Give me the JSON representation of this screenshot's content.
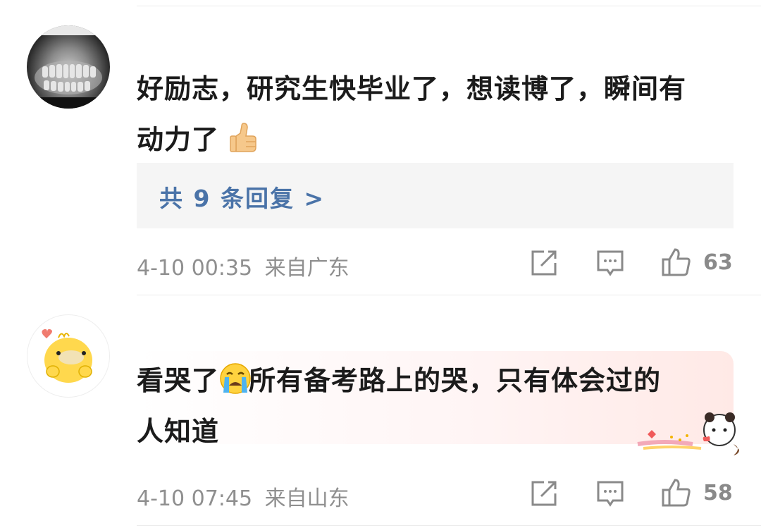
{
  "comments": [
    {
      "avatar": "x-ray-avatar",
      "text_part1": "好励志，研究生快毕业了，想读博了，瞬间有",
      "text_part2": "动力了",
      "emoji": "thumbs-up",
      "reply_link": "共 9 条回复 >",
      "time": "4-10 00:35",
      "location": "来自广东",
      "likes": "63"
    },
    {
      "avatar": "duck-avatar",
      "text_part1": "看哭了",
      "emoji": "loudly-crying-face",
      "text_part2": "所有备考路上的哭，只有体会过的",
      "text_part3": "人知道",
      "time": "4-10 07:45",
      "location": "来自山东",
      "likes": "58"
    }
  ],
  "colors": {
    "link": "#4a73a8",
    "meta": "#8f8f8f",
    "reply_bg": "#f5f5f5"
  }
}
